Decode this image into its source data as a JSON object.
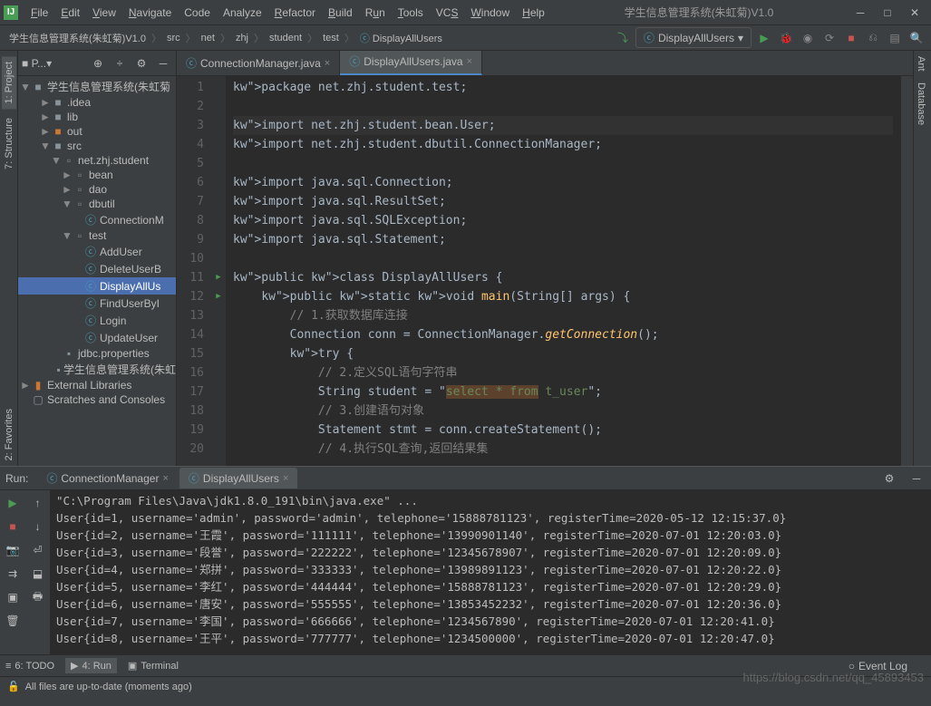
{
  "window_title": "学生信息管理系统(朱虹菊)V1.0",
  "menu": {
    "file": "File",
    "edit": "Edit",
    "view": "View",
    "navigate": "Navigate",
    "code": "Code",
    "analyze": "Analyze",
    "refactor": "Refactor",
    "build": "Build",
    "run": "Run",
    "tools": "Tools",
    "vcs": "VCS",
    "window": "Window",
    "help": "Help"
  },
  "breadcrumbs": [
    "学生信息管理系统(朱虹菊)V1.0",
    "src",
    "net",
    "zhj",
    "student",
    "test",
    "DisplayAllUsers"
  ],
  "run_config": "DisplayAllUsers",
  "project": {
    "header": "P...",
    "root": "学生信息管理系统(朱虹菊",
    "items": [
      {
        "label": ".idea",
        "indent": 2,
        "icon": "folder",
        "expand": "►"
      },
      {
        "label": "lib",
        "indent": 2,
        "icon": "folder",
        "expand": "►"
      },
      {
        "label": "out",
        "indent": 2,
        "icon": "folder-out",
        "expand": "►"
      },
      {
        "label": "src",
        "indent": 2,
        "icon": "folder",
        "expand": "▼"
      },
      {
        "label": "net.zhj.student",
        "indent": 3,
        "icon": "package",
        "expand": "▼"
      },
      {
        "label": "bean",
        "indent": 4,
        "icon": "package",
        "expand": "►"
      },
      {
        "label": "dao",
        "indent": 4,
        "icon": "package",
        "expand": "►"
      },
      {
        "label": "dbutil",
        "indent": 4,
        "icon": "package",
        "expand": "▼"
      },
      {
        "label": "ConnectionM",
        "indent": 5,
        "icon": "class",
        "expand": ""
      },
      {
        "label": "test",
        "indent": 4,
        "icon": "package",
        "expand": "▼"
      },
      {
        "label": "AddUser",
        "indent": 5,
        "icon": "class",
        "expand": ""
      },
      {
        "label": "DeleteUserB",
        "indent": 5,
        "icon": "class",
        "expand": ""
      },
      {
        "label": "DisplayAllUs",
        "indent": 5,
        "icon": "class",
        "expand": "",
        "selected": true
      },
      {
        "label": "FindUserByI",
        "indent": 5,
        "icon": "class",
        "expand": ""
      },
      {
        "label": "Login",
        "indent": 5,
        "icon": "class",
        "expand": ""
      },
      {
        "label": "UpdateUser",
        "indent": 5,
        "icon": "class",
        "expand": ""
      },
      {
        "label": "jdbc.properties",
        "indent": 3,
        "icon": "file",
        "expand": ""
      },
      {
        "label": "学生信息管理系统(朱虹",
        "indent": 3,
        "icon": "file",
        "expand": ""
      }
    ],
    "external": "External Libraries",
    "scratches": "Scratches and Consoles"
  },
  "editor_tabs": [
    {
      "label": "ConnectionManager.java",
      "active": false
    },
    {
      "label": "DisplayAllUsers.java",
      "active": true
    }
  ],
  "code": {
    "lines": [
      {
        "n": 1,
        "t": "package net.zhj.student.test;"
      },
      {
        "n": 2,
        "t": ""
      },
      {
        "n": 3,
        "t": "import net.zhj.student.bean.User;"
      },
      {
        "n": 4,
        "t": "import net.zhj.student.dbutil.ConnectionManager;"
      },
      {
        "n": 5,
        "t": ""
      },
      {
        "n": 6,
        "t": "import java.sql.Connection;"
      },
      {
        "n": 7,
        "t": "import java.sql.ResultSet;"
      },
      {
        "n": 8,
        "t": "import java.sql.SQLException;"
      },
      {
        "n": 9,
        "t": "import java.sql.Statement;"
      },
      {
        "n": 10,
        "t": ""
      },
      {
        "n": 11,
        "t": "public class DisplayAllUsers {"
      },
      {
        "n": 12,
        "t": "    public static void main(String[] args) {"
      },
      {
        "n": 13,
        "t": "        // 1.获取数据库连接"
      },
      {
        "n": 14,
        "t": "        Connection conn = ConnectionManager.getConnection();"
      },
      {
        "n": 15,
        "t": "        try {"
      },
      {
        "n": 16,
        "t": "            // 2.定义SQL语句字符串"
      },
      {
        "n": 17,
        "t": "            String student = \"select * from t_user\";"
      },
      {
        "n": 18,
        "t": "            // 3.创建语句对象"
      },
      {
        "n": 19,
        "t": "            Statement stmt = conn.createStatement();"
      },
      {
        "n": 20,
        "t": "            // 4.执行SQL查询,返回结果集"
      }
    ]
  },
  "side_tabs_left": [
    "1: Project",
    "7: Structure",
    "2: Favorites"
  ],
  "side_tabs_right": [
    "Ant",
    "Database"
  ],
  "run_panel": {
    "title": "Run:",
    "tabs": [
      {
        "label": "ConnectionManager",
        "active": false
      },
      {
        "label": "DisplayAllUsers",
        "active": true
      }
    ],
    "output": [
      "\"C:\\Program Files\\Java\\jdk1.8.0_191\\bin\\java.exe\" ...",
      "User{id=1, username='admin', password='admin', telephone='15888781123', registerTime=2020-05-12 12:15:37.0}",
      "User{id=2, username='王霞', password='111111', telephone='13990901140', registerTime=2020-07-01 12:20:03.0}",
      "User{id=3, username='段誉', password='222222', telephone='12345678907', registerTime=2020-07-01 12:20:09.0}",
      "User{id=4, username='郑拼', password='333333', telephone='13989891123', registerTime=2020-07-01 12:20:22.0}",
      "User{id=5, username='李红', password='444444', telephone='15888781123', registerTime=2020-07-01 12:20:29.0}",
      "User{id=6, username='唐安', password='555555', telephone='13853452232', registerTime=2020-07-01 12:20:36.0}",
      "User{id=7, username='李国', password='666666', telephone='1234567890', registerTime=2020-07-01 12:20:41.0}",
      "User{id=8, username='王平', password='777777', telephone='1234500000', registerTime=2020-07-01 12:20:47.0}"
    ]
  },
  "bottom": {
    "todo": "6: TODO",
    "run": "4: Run",
    "terminal": "Terminal",
    "event_log": "Event Log"
  },
  "status": "All files are up-to-date (moments ago)",
  "watermark": "https://blog.csdn.net/qq_45893453"
}
